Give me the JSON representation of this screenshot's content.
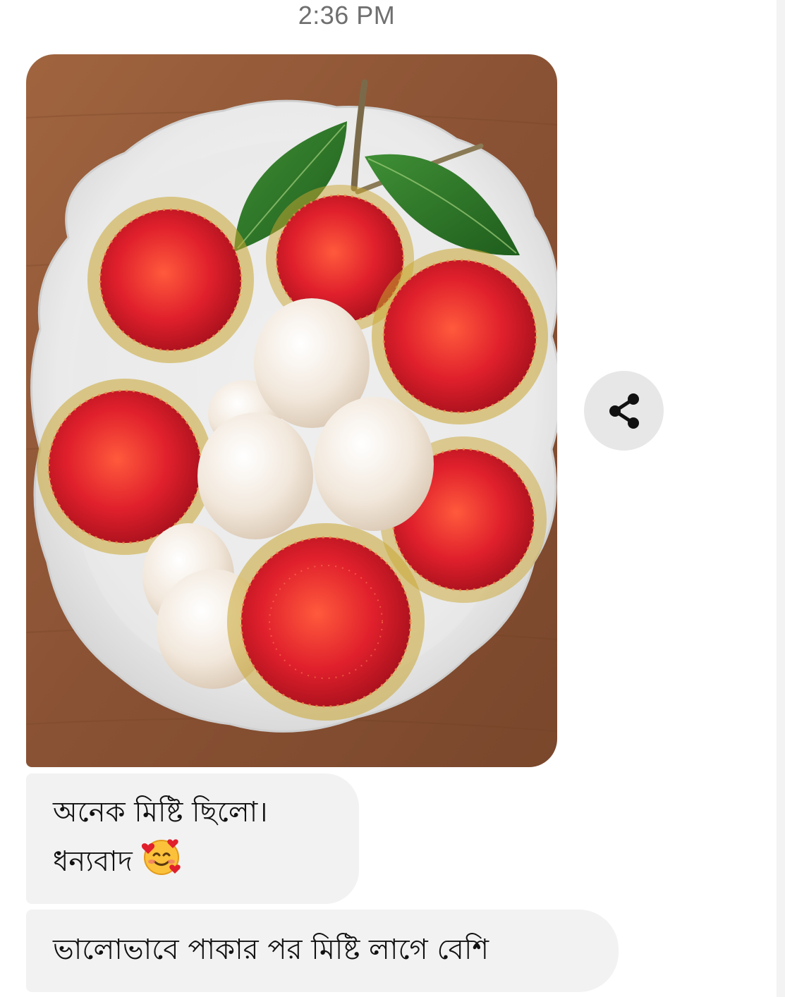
{
  "status": {
    "timestamp": "2:36 PM"
  },
  "messages": [
    {
      "type": "photo",
      "image": {
        "subject": "bowl-of-rambutans",
        "colors": {
          "table": "#8a5234",
          "bowl": "#eeeeee",
          "rambutan": "#e0202c",
          "peeled_fruit": "#f2e8dc",
          "leaf": "#2f7a2a"
        }
      }
    },
    {
      "type": "text",
      "lines": [
        "অনেক মিষ্টি ছিলো।",
        "ধন্যবাদ"
      ],
      "emoji": "smiling-face-with-hearts"
    },
    {
      "type": "text",
      "text": "ভালোভাবে পাকার পর মিষ্টি লাগে বেশি"
    }
  ],
  "actions": {
    "share_icon": "share-icon"
  }
}
